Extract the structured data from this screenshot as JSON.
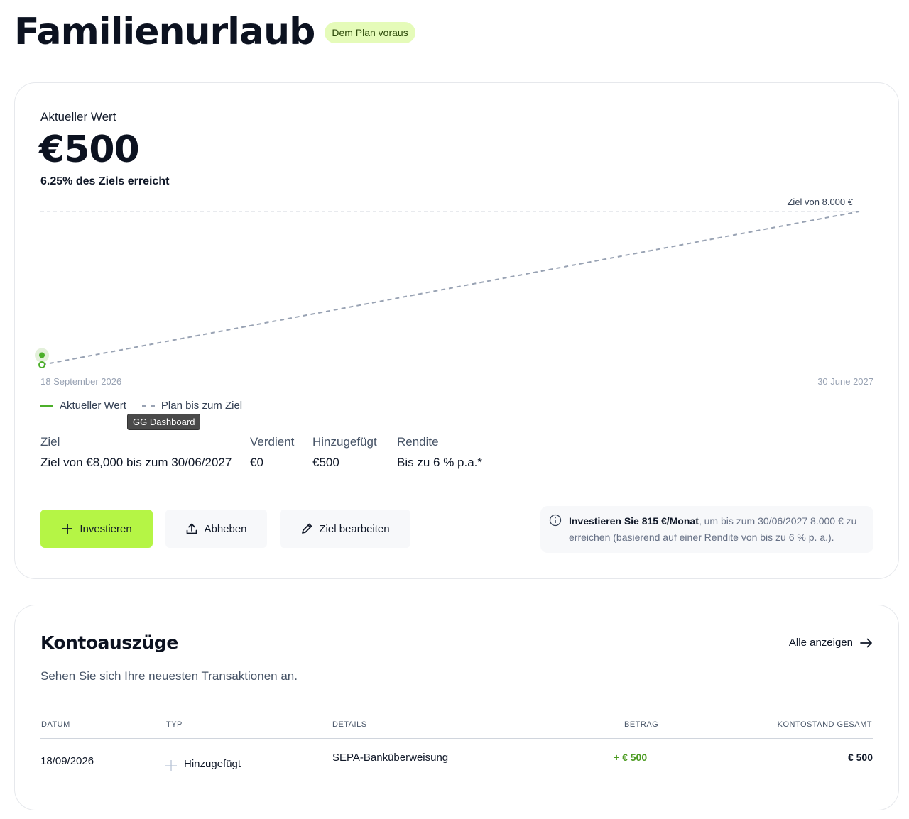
{
  "page": {
    "title": "Familienurlaub",
    "status_badge": "Dem Plan voraus"
  },
  "goal_card": {
    "current_label": "Aktueller Wert",
    "current_value": "€500",
    "progress_text": "6.25% des Ziels erreicht",
    "legend": {
      "current": "Aktueller Wert",
      "plan": "Plan bis zum Ziel"
    },
    "tooltip": "GG Dashboard",
    "stats": [
      {
        "label": "Ziel",
        "value": "Ziel von €8,000 bis zum 30/06/2027"
      },
      {
        "label": "Verdient",
        "value": "€0"
      },
      {
        "label": "Hinzugefügt",
        "value": "€500"
      },
      {
        "label": "Rendite",
        "value": "Bis zu 6 % p.a.*"
      }
    ],
    "buttons": {
      "invest": "Investieren",
      "withdraw": "Abheben",
      "edit": "Ziel bearbeiten"
    },
    "info": {
      "bold": "Investieren Sie 815 €/Monat",
      "rest": ", um bis zum 30/06/2027 8.000 € zu erreichen (basierend auf einer Rendite von bis zu 6 % p. a.)."
    }
  },
  "chart_data": {
    "type": "line",
    "x_start_label": "18 September 2026",
    "x_end_label": "30 June 2027",
    "goal_label": "Ziel von 8.000 €",
    "goal_value": 8000,
    "ylim": [
      0,
      8000
    ],
    "series": [
      {
        "name": "Aktueller Wert",
        "x": [
          "18 September 2026"
        ],
        "values": [
          500
        ],
        "style": "solid",
        "color": "#4caf2a"
      },
      {
        "name": "Plan bis zum Ziel",
        "x": [
          "18 September 2026",
          "30 June 2027"
        ],
        "values": [
          0,
          8000
        ],
        "style": "dashed",
        "color": "#98a2b3"
      }
    ],
    "grid": false,
    "legend": "bottom-left"
  },
  "statements": {
    "title": "Kontoauszüge",
    "subtitle": "Sehen Sie sich Ihre neuesten Transaktionen an.",
    "view_all": "Alle anzeigen",
    "columns": [
      "DATUM",
      "TYP",
      "DETAILS",
      "BETRAG",
      "KONTOSTAND GESAMT"
    ],
    "rows": [
      {
        "date": "18/09/2026",
        "type": "Hinzugefügt",
        "details": "SEPA-Banküberweisung",
        "amount": "+ € 500",
        "balance": "€ 500"
      }
    ]
  },
  "colors": {
    "accent": "#b5f545",
    "badge_bg": "#e5fbb9",
    "positive": "#4caf2a",
    "plan_line": "#98a2b3"
  }
}
